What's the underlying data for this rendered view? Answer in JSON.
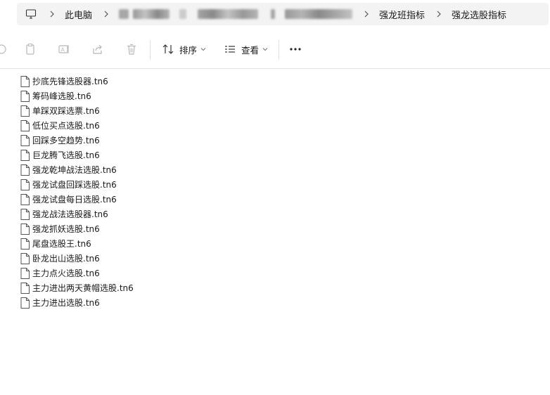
{
  "breadcrumb": {
    "root_icon": "computer-icon",
    "items": [
      "此电脑",
      "强龙班指标",
      "强龙选股指标"
    ],
    "redacted_segments": 3
  },
  "toolbar": {
    "sort_label": "排序",
    "view_label": "查看",
    "more_glyph": "···"
  },
  "files": [
    {
      "name": "抄底先锋选股器.tn6"
    },
    {
      "name": "筹码峰选股.tn6"
    },
    {
      "name": "单踩双踩选票.tn6"
    },
    {
      "name": "低位买点选股.tn6"
    },
    {
      "name": "回踩多空趋势.tn6"
    },
    {
      "name": "巨龙腾飞选股.tn6"
    },
    {
      "name": "强龙乾坤战法选股.tn6"
    },
    {
      "name": "强龙试盘回踩选股.tn6"
    },
    {
      "name": "强龙试盘每日选股.tn6"
    },
    {
      "name": "强龙战法选股器.tn6"
    },
    {
      "name": "强龙抓妖选股.tn6"
    },
    {
      "name": "尾盘选股王.tn6"
    },
    {
      "name": "卧龙出山选股.tn6"
    },
    {
      "name": "主力点火选股.tn6"
    },
    {
      "name": "主力进出两天黄帽选股.tn6"
    },
    {
      "name": "主力进出选股.tn6"
    }
  ],
  "colors": {
    "address_bg": "#f3f3f3",
    "icon_gray": "#8a8a8a",
    "icon_dark": "#444444",
    "divider": "#e3e3e3"
  }
}
